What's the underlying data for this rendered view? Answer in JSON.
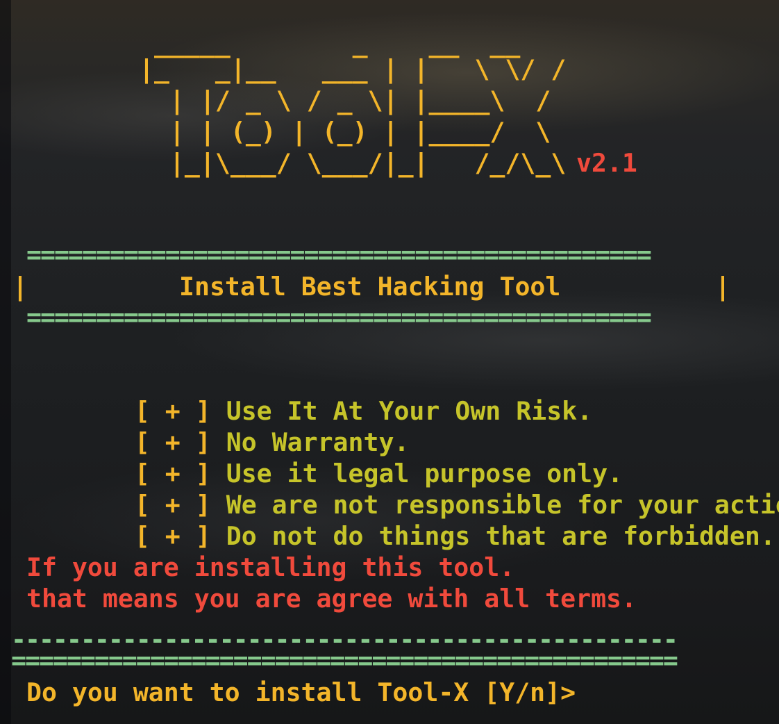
{
  "logo": {
    "lines": [
      " _____        _    __  __",
      "|_   _|__   ___ | |   \\ \\/ /",
      "  | |/ _ \\ / _ \\| |____\\  /",
      "  | | (_) | (_) | |____/  \\",
      "  |_|\\___/ \\___/|_|   /_/\\_\\"
    ],
    "version": "v2.1"
  },
  "separators": {
    "double_line": "=============================================",
    "dash_line": "------------------------------------------------",
    "bottom_double_line": "================================================"
  },
  "banner": {
    "left_bar": "|",
    "title": "Install Best Hacking Tool",
    "right_bar": "|"
  },
  "terms": {
    "bullet": "[ + ]",
    "items": [
      "Use It At Your Own Risk.",
      "No Warranty.",
      "Use it legal purpose only.",
      "We are not responsible for your actions.",
      "Do not do things that are forbidden."
    ]
  },
  "notice": {
    "line1": "If you are installing this tool.",
    "line2": "that means you are agree with all terms."
  },
  "prompt": {
    "text": "Do you want to install Tool-X [Y/n]>"
  },
  "colors": {
    "logo": "#f3b52a",
    "version": "#f04a3c",
    "separator": "#86c98c",
    "terms_text": "#c6c42a",
    "notice": "#f04a3c",
    "prompt": "#f3b52a"
  }
}
